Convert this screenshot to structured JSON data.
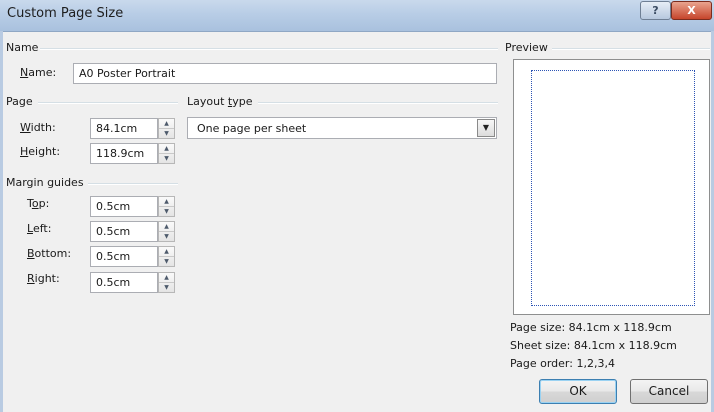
{
  "window": {
    "title": "Custom Page Size",
    "help_label": "?",
    "close_label": "X"
  },
  "name_group": {
    "header": "Name",
    "name_label_key": "N",
    "name_label_rest": "ame:",
    "name_value": "A0 Poster Portrait"
  },
  "page_group": {
    "header": "Page",
    "width_label_key": "W",
    "width_label_rest": "idth:",
    "width_value": "84.1cm",
    "height_label_key": "H",
    "height_label_rest": "eight:",
    "height_value": "118.9cm"
  },
  "layout_group": {
    "header_pre": "Layout ",
    "header_key": "t",
    "header_rest": "ype",
    "selected": "One page per sheet"
  },
  "margin_group": {
    "header": "Margin guides",
    "top_label_pre": "T",
    "top_label_key": "o",
    "top_label_rest": "p:",
    "top_value": "0.5cm",
    "left_label_key": "L",
    "left_label_rest": "eft:",
    "left_value": "0.5cm",
    "bottom_label_key": "B",
    "bottom_label_rest": "ottom:",
    "bottom_value": "0.5cm",
    "right_label_key": "R",
    "right_label_rest": "ight:",
    "right_value": "0.5cm"
  },
  "preview": {
    "header": "Preview",
    "page_size": "Page size: 84.1cm x 118.9cm",
    "sheet_size": "Sheet size: 84.1cm x 118.9cm",
    "page_order": "Page order: 1,2,3,4"
  },
  "buttons": {
    "ok": "OK",
    "cancel": "Cancel"
  },
  "icons": {
    "spin": "spin-arrows-icon",
    "dropdown": "chevron-down-icon"
  }
}
